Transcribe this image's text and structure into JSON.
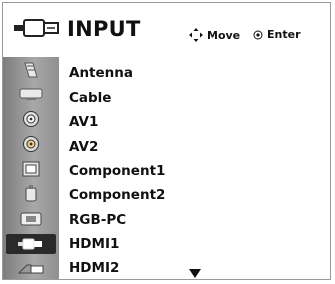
{
  "header": {
    "title": "INPUT",
    "hints": {
      "move": "Move",
      "enter": "Enter"
    }
  },
  "inputs": [
    {
      "label": "Antenna",
      "icon": "antenna-icon"
    },
    {
      "label": "Cable",
      "icon": "cable-icon"
    },
    {
      "label": "AV1",
      "icon": "av1-connector-icon"
    },
    {
      "label": "AV2",
      "icon": "av2-connector-icon"
    },
    {
      "label": "Component1",
      "icon": "component1-connector-icon"
    },
    {
      "label": "Component2",
      "icon": "component2-connector-icon"
    },
    {
      "label": "RGB-PC",
      "icon": "rgb-pc-connector-icon"
    },
    {
      "label": "HDMI1",
      "icon": "hdmi1-connector-icon",
      "selected": true
    },
    {
      "label": "HDMI2",
      "icon": "hdmi2-connector-icon"
    }
  ],
  "colors": {
    "sidebar": "#9a9a9a",
    "selected_icon_bg": "#2a2a2a",
    "text": "#111111"
  }
}
